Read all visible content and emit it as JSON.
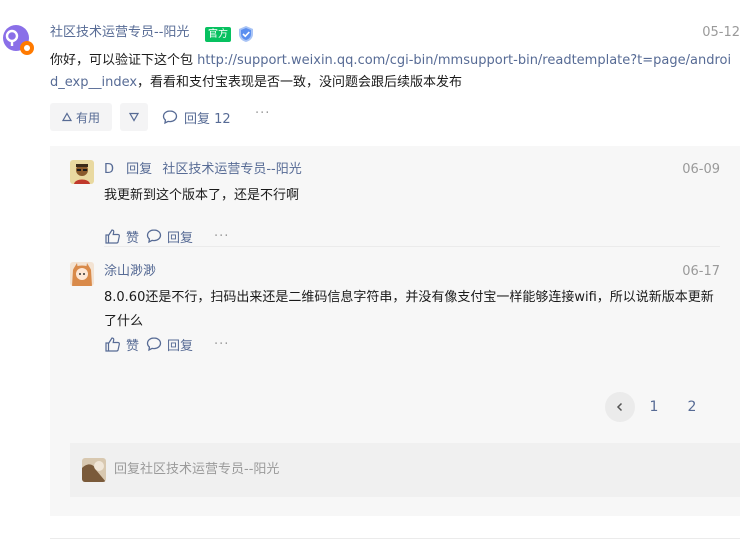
{
  "comment": {
    "author": "社区技术运营专员--阳光",
    "badge": "官方",
    "date": "05-12",
    "text_prefix": "你好，可以验证下这个包 ",
    "link": "http://support.weixin.qq.com/cgi-bin/mmsupport-bin/readtemplate?t=page/android_exp__index",
    "text_suffix": "，看看和支付宝表现是否一致，没问题会跟后续版本发布",
    "useful_label": "有用",
    "reply_label": "回复 12",
    "more": "···"
  },
  "replies": [
    {
      "user": "D",
      "reply_word": "回复",
      "reply_to": "社区技术运营专员--阳光",
      "date": "06-09",
      "text": "我更新到这个版本了，还是不行啊",
      "like_label": "赞",
      "reply_label": "回复",
      "more": "···"
    },
    {
      "user": "涂山渺渺",
      "date": "06-17",
      "text": "8.0.60还是不行，扫码出来还是二维码信息字符串，并没有像支付宝一样能够连接wifi，所以说新版本更新了什么",
      "like_label": "赞",
      "reply_label": "回复",
      "more": "···"
    }
  ],
  "pagination": {
    "pages": [
      "1",
      "2"
    ],
    "current": "2"
  },
  "reply_box": {
    "placeholder": "回复社区技术运营专员--阳光"
  },
  "colors": {
    "link": "#576b95",
    "official_badge": "#07c160",
    "muted": "#9a9a9a"
  }
}
